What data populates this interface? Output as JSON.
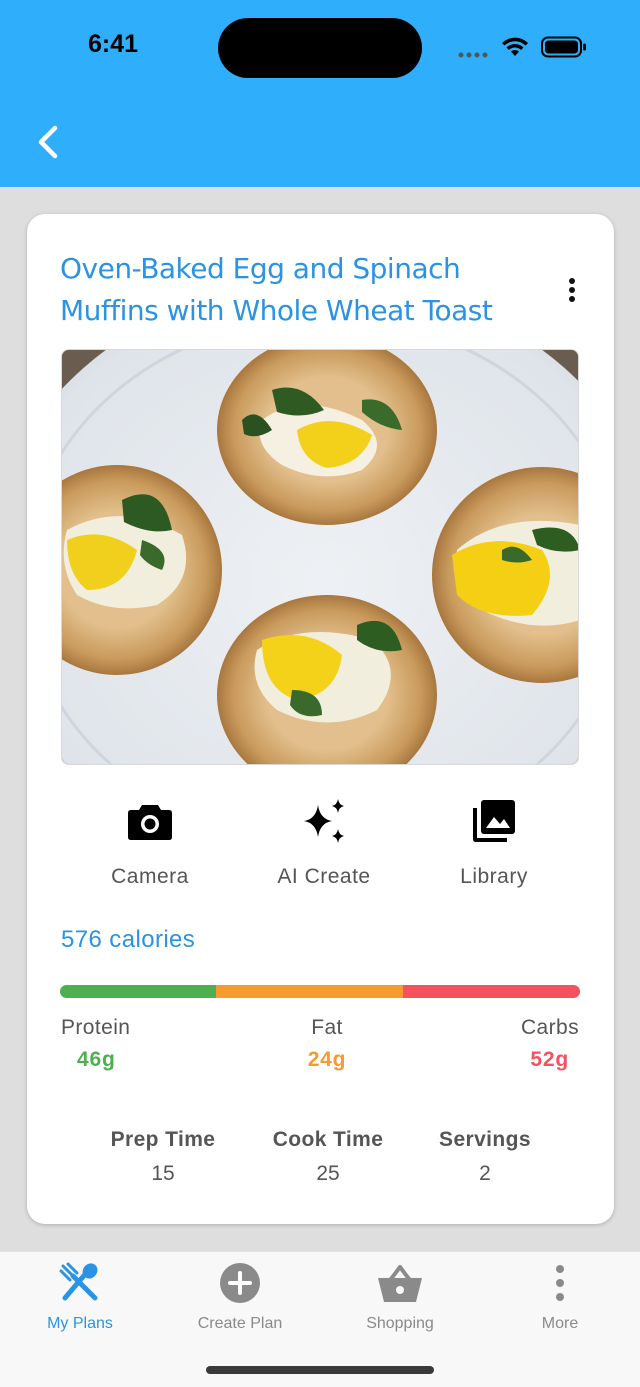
{
  "status_bar": {
    "time": "6:41"
  },
  "header": {
    "back_icon": "chevron-left-icon"
  },
  "recipe": {
    "title": "Oven-Baked Egg and Spinach Muffins with Whole Wheat Toast",
    "menu_icon": "more-vertical-icon",
    "photo_alt": "egg-and-spinach-muffins-photo"
  },
  "image_actions": [
    {
      "label": "Camera",
      "icon": "camera-icon"
    },
    {
      "label": "AI Create",
      "icon": "sparkles-icon"
    },
    {
      "label": "Library",
      "icon": "photo-library-icon"
    }
  ],
  "nutrition": {
    "calories_text": "576 calories",
    "bar_fractions": {
      "protein": 0.3,
      "fat": 0.36,
      "carbs": 0.34
    },
    "macros": [
      {
        "name": "Protein",
        "value": "46g",
        "color": "#4caf50"
      },
      {
        "name": "Fat",
        "value": "24g",
        "color": "#f79a2f"
      },
      {
        "name": "Carbs",
        "value": "52g",
        "color": "#f4525e"
      }
    ]
  },
  "details": [
    {
      "label": "Prep Time",
      "value": "15"
    },
    {
      "label": "Cook Time",
      "value": "25"
    },
    {
      "label": "Servings",
      "value": "2"
    }
  ],
  "tabs": [
    {
      "label": "My Plans",
      "icon": "utensils-icon",
      "active": true
    },
    {
      "label": "Create Plan",
      "icon": "plus-circle-icon",
      "active": false
    },
    {
      "label": "Shopping",
      "icon": "basket-icon",
      "active": false
    },
    {
      "label": "More",
      "icon": "more-vertical-icon",
      "active": false
    }
  ],
  "colors": {
    "header_bg": "#2eaefb",
    "accent": "#2a93e4",
    "protein": "#4caf50",
    "fat": "#f79a2f",
    "carbs": "#f4525e"
  }
}
